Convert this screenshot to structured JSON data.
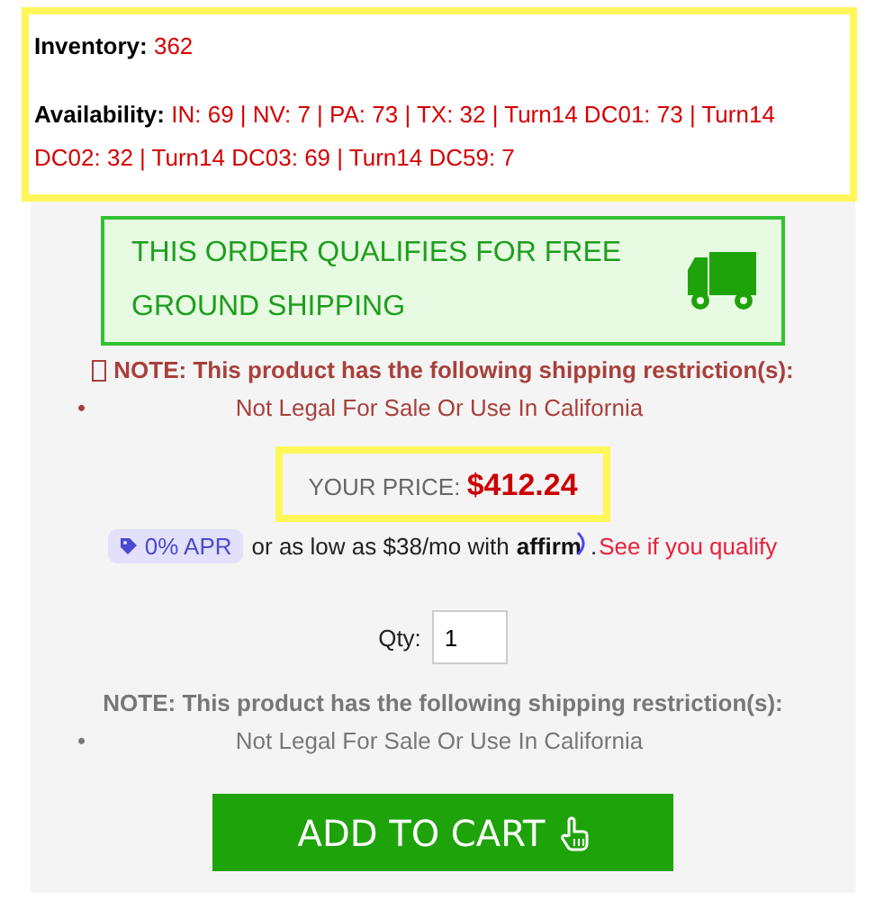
{
  "stock": {
    "inventory": {
      "label": "Inventory:",
      "value": "362"
    },
    "availability": {
      "label": "Availability:",
      "value": "IN: 69 | NV: 7 | PA: 73 | TX: 32 | Turn14 DC01: 73 | Turn14 DC02: 32 | Turn14 DC03: 69 | Turn14 DC59: 7"
    }
  },
  "shipping_banner": {
    "text": "THIS ORDER QUALIFIES FOR FREE GROUND SHIPPING"
  },
  "notes": [
    {
      "kind": "warning",
      "text": "NOTE: This product has the following shipping restriction(s):",
      "restrictions": [
        {
          "bullet": "•",
          "text": "Not Legal For Sale Or Use In California"
        }
      ]
    },
    {
      "kind": "plain",
      "text": "NOTE: This product has the following shipping restriction(s):",
      "restrictions": [
        {
          "bullet": "•",
          "text": "Not Legal For Sale Or Use In California"
        }
      ]
    }
  ],
  "price": {
    "label": "YOUR PRICE:",
    "value": "$412.24"
  },
  "financing": {
    "badge": "0% APR",
    "text": "or as low as $38/mo with",
    "logo": "affirm",
    "period": ".",
    "link": "See if you qualify"
  },
  "quantity": {
    "label": "Qty:",
    "value": "1"
  },
  "add_to_cart": {
    "label": "ADD TO CART"
  }
}
